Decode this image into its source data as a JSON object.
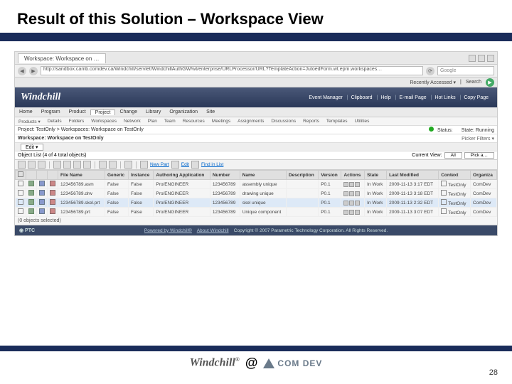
{
  "slide": {
    "title": "Result of this Solution – Workspace View",
    "pagenum": "28"
  },
  "browser": {
    "tab": "Workspace: Workspace on …",
    "url": "http://sandbox.camb.comdev.ca/Windchill/servlet/WindchillAuthGW/wt/enterprise/URLProcessor/URL?TemplateAction=JutoedForm.wt.epm.workspaces…",
    "google": "Google",
    "recent": "Recently Accessed ▾",
    "search": "Search"
  },
  "app": {
    "logo": "Windchill",
    "links": [
      "Event Manager",
      "Clipboard",
      "Help",
      "E-mail Page",
      "Hot Links",
      "Copy Page"
    ]
  },
  "menu": [
    "Home",
    "Program",
    "Product",
    "Project",
    "Change",
    "Library",
    "Organization",
    "Site"
  ],
  "submenu": [
    "Products ▾",
    "Details",
    "Folders",
    "Workspaces",
    "Network",
    "Plan",
    "Team",
    "Resources",
    "Meetings",
    "Assignments",
    "Discussions",
    "Reports",
    "Templates",
    "Utilities"
  ],
  "crumb": {
    "path": "Project: TestOnly > Workspaces: Workspace on TestOnly",
    "status_label": "Status:",
    "state_label": "State: Running"
  },
  "ws": {
    "label": "Workspace: Workspace on TestOnly",
    "picker": "Picker Filters ▾"
  },
  "edit": "Edit ▾",
  "objlist": {
    "label": "Object List (4 of 4 total objects)",
    "cv_label": "Current View:",
    "cv_value": "All",
    "pick": "Pick a…"
  },
  "toolbar": {
    "links": [
      "New Part",
      "Edit",
      "Find in List"
    ]
  },
  "columns": [
    "",
    "",
    "",
    "",
    "File Name",
    "Generic",
    "Instance",
    "Authoring Application",
    "Number",
    "Name",
    "Description",
    "Version",
    "Actions",
    "State",
    "Last Modified",
    "Context",
    "Organiza"
  ],
  "rows": [
    {
      "file": "123456789.asm",
      "gen": "False",
      "inst": "False",
      "app": "Pro/ENGINEER",
      "num": "123456789",
      "name": "assembly unique",
      "ver": "P0.1",
      "state": "In Work",
      "mod": "2009-11-13  3:17 EDT",
      "ctx": "TestOnly",
      "org": "ComDev"
    },
    {
      "file": "123456789.drw",
      "gen": "False",
      "inst": "False",
      "app": "Pro/ENGINEER",
      "num": "123456789",
      "name": "drawing unique",
      "ver": "P0.1",
      "state": "In Work",
      "mod": "2009-11-13  3:18 EDT",
      "ctx": "TestOnly",
      "org": "ComDev"
    },
    {
      "file": "123456789.skel.prt",
      "gen": "False",
      "inst": "False",
      "app": "Pro/ENGINEER",
      "num": "123456789",
      "name": "skel unique",
      "ver": "P0.1",
      "state": "In Work",
      "mod": "2009-11-13  2:32 EDT",
      "ctx": "TestOnly",
      "org": "ComDev"
    },
    {
      "file": "123456789.prt",
      "gen": "False",
      "inst": "False",
      "app": "Pro/ENGINEER",
      "num": "123456789",
      "name": "Unique component",
      "ver": "P0.1",
      "state": "In Work",
      "mod": "2009-11-13  3:07 EDT",
      "ctx": "TestOnly",
      "org": "ComDev"
    }
  ],
  "selcount": "(0 objects selected)",
  "footer": {
    "ptc": "◉ PTC",
    "powered": "Powered by Windchill®",
    "about": "About Windchill",
    "copy": "Copyright © 2007 Parametric Technology Corporation. All Rights Reserved."
  },
  "logos": {
    "wc": "Windchill",
    "reg": "®",
    "at": "@",
    "cd": "COM DEV"
  }
}
